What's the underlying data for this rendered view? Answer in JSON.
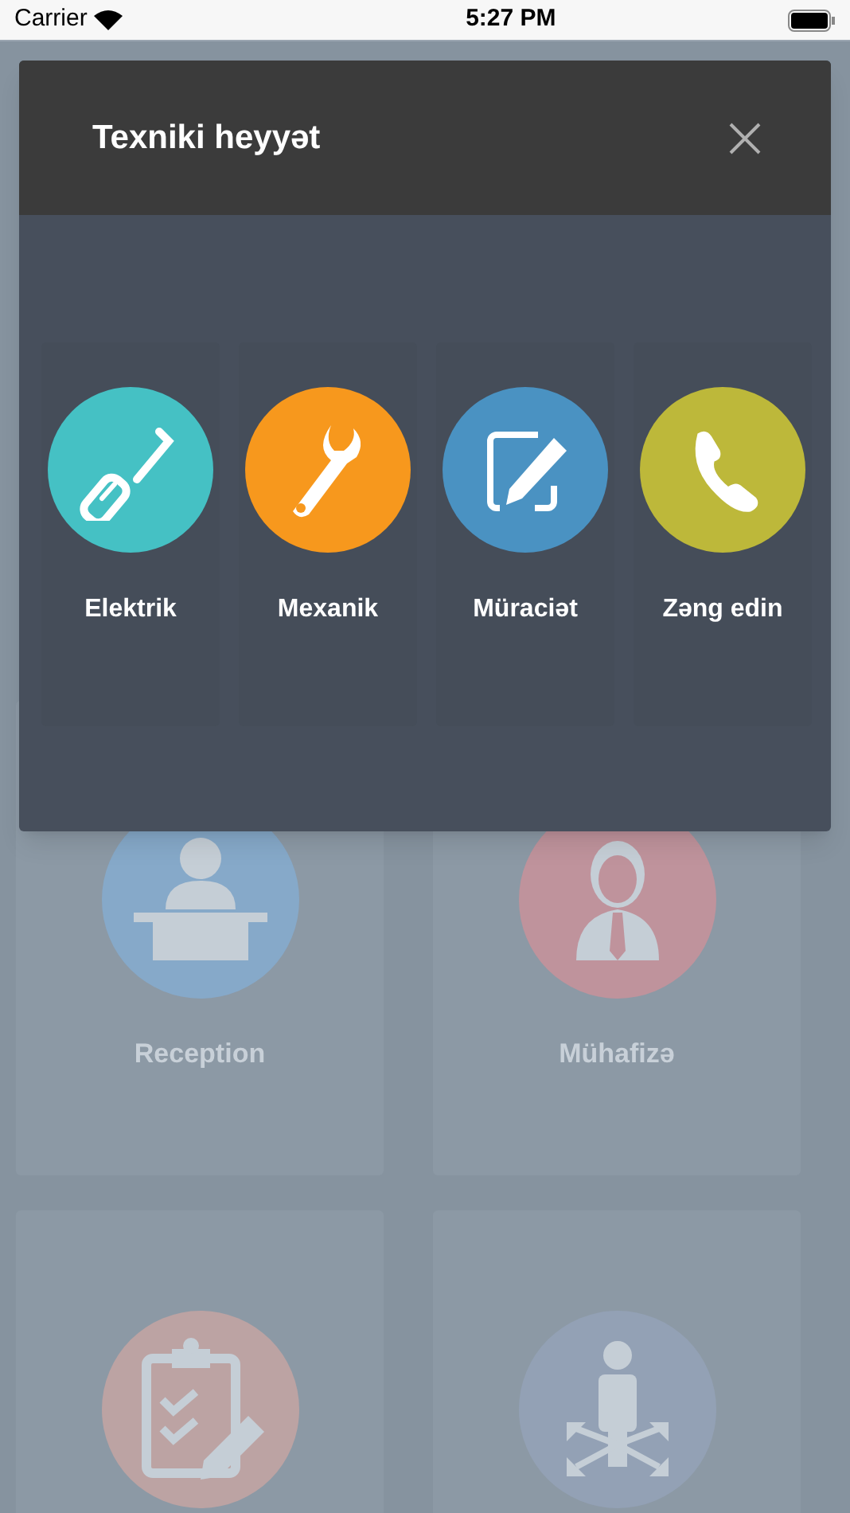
{
  "status_bar": {
    "carrier": "Carrier",
    "time": "5:27 PM"
  },
  "background_tiles": [
    {
      "label": "Reception",
      "color": "#86a9c9",
      "kind": "reception"
    },
    {
      "label": "Mühafizə",
      "color": "#bf939c",
      "kind": "guard"
    },
    {
      "color": "#bca3a3",
      "kind": "checklist"
    },
    {
      "color": "#93a1b5",
      "kind": "distribution"
    }
  ],
  "dialog": {
    "title": "Texniki heyyət",
    "options": [
      {
        "label": "Elektrik",
        "color": "#45c1c4",
        "kind": "screwdriver"
      },
      {
        "label": "Mexanik",
        "color": "#f7981d",
        "kind": "wrench"
      },
      {
        "label": "Müraciət",
        "color": "#4a92c2",
        "kind": "edit"
      },
      {
        "label": "Zəng edin",
        "color": "#bdb83a",
        "kind": "phone"
      }
    ]
  }
}
